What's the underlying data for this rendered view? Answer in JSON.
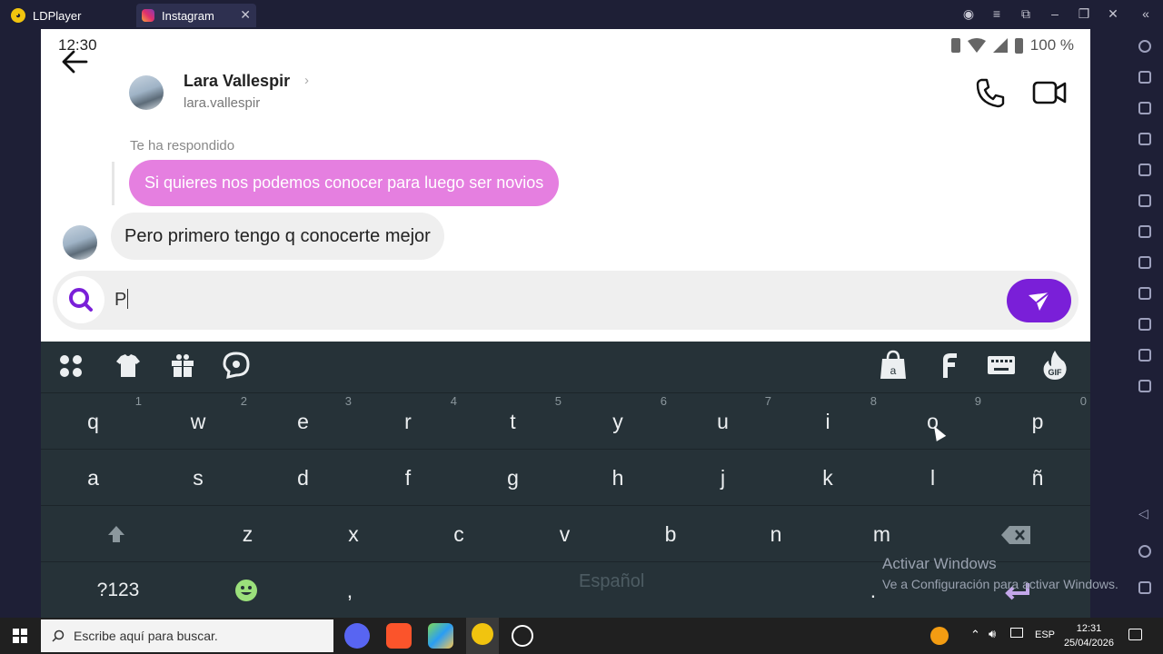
{
  "window": {
    "tab1_label": "LDPlayer",
    "tab2_label": "Instagram"
  },
  "status_bar": {
    "time": "12:30",
    "battery": "100 %"
  },
  "header": {
    "name": "Lara Vallespir",
    "username": "lara.vallespir"
  },
  "chat": {
    "reply_label": "Te ha respondido",
    "replied_message": "Si quieres nos podemos conocer para luego ser novios",
    "message": "Pero primero tengo q conocerte mejor"
  },
  "composer": {
    "value": "P"
  },
  "keyboard": {
    "row1": [
      "q",
      "w",
      "e",
      "r",
      "t",
      "y",
      "u",
      "i",
      "o",
      "p"
    ],
    "row1_hints": [
      "1",
      "2",
      "3",
      "4",
      "5",
      "6",
      "7",
      "8",
      "9",
      "0"
    ],
    "row2": [
      "a",
      "s",
      "d",
      "f",
      "g",
      "h",
      "j",
      "k",
      "l",
      "ñ"
    ],
    "row3": [
      "z",
      "x",
      "c",
      "v",
      "b",
      "n",
      "m"
    ],
    "symbols_key": "?123",
    "comma_key": ",",
    "period_key": ".",
    "language": "Español"
  },
  "watermark": {
    "title": "Activar Windows",
    "subtitle": "Ve a Configuración para activar Windows."
  },
  "taskbar": {
    "search_placeholder": "Escribe aquí para buscar.",
    "language": "ESP",
    "clock_time": "12:31",
    "clock_date": "25/04/2026"
  },
  "colors": {
    "sent_bubble": "#e57fe0",
    "send_button": "#7a1fd8",
    "keyboard_bg": "#263238"
  }
}
